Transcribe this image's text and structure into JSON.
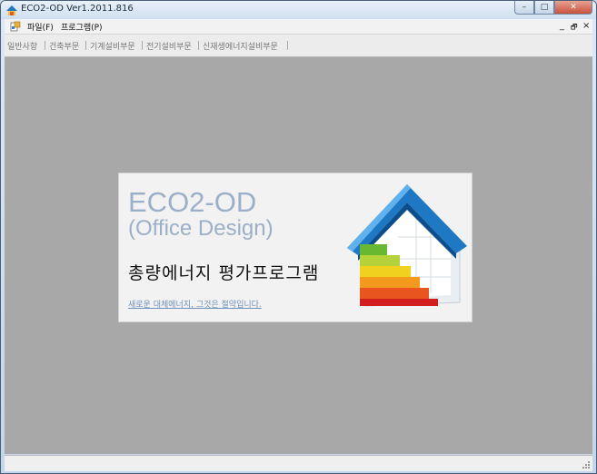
{
  "window": {
    "title": "ECO2-OD Ver1.2011.816"
  },
  "title_buttons": {
    "minimize": "–",
    "maximize": "□",
    "close": "✕"
  },
  "menu": {
    "items": [
      {
        "label": "파일(F)"
      },
      {
        "label": "프로그램(P)"
      }
    ],
    "mdi_controls": {
      "minimize": "_",
      "restore": "🗗",
      "close": "×"
    }
  },
  "toolbar": {
    "items": [
      {
        "label": "일반사항"
      },
      {
        "label": "건축부문"
      },
      {
        "label": "기계설비부문"
      },
      {
        "label": "전기설비부문"
      },
      {
        "label": "신재생에너지설비부문"
      }
    ]
  },
  "splash": {
    "brand": "ECO2-OD",
    "subtitle": "(Office Design)",
    "program_name": "총량에너지 평가프로그램",
    "slogan": "새로운 대체에너지, 그것은 절약입니다."
  },
  "colors": {
    "client_bg": "#a8a8a8",
    "brand_text": "#9bb0c8",
    "house_roof": "#1f78c4",
    "energy_bars": [
      "#69b832",
      "#b4d23a",
      "#f0d21e",
      "#f39a1e",
      "#e8551e",
      "#d21e1e"
    ]
  }
}
